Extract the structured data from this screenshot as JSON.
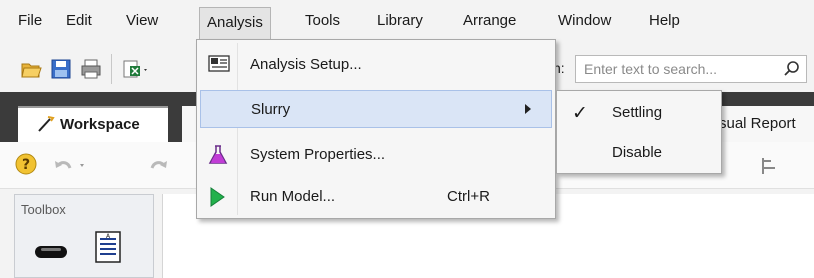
{
  "menubar": {
    "items": [
      {
        "label": "File"
      },
      {
        "label": "Edit"
      },
      {
        "label": "View"
      },
      {
        "label": "Analysis"
      },
      {
        "label": "Tools"
      },
      {
        "label": "Library"
      },
      {
        "label": "Arrange"
      },
      {
        "label": "Window"
      },
      {
        "label": "Help"
      }
    ]
  },
  "toolbar": {
    "search_label": "n:",
    "search_placeholder": "Enter text to search..."
  },
  "tabs": {
    "workspace": "Workspace",
    "visual_report_partial": "sual Report"
  },
  "analysis_menu": {
    "items": [
      {
        "label": "Analysis Setup...",
        "icon": "analysis-setup-icon"
      },
      {
        "label": "Slurry",
        "icon": "",
        "submenu": true
      },
      {
        "label": "System Properties...",
        "icon": "flask-icon"
      },
      {
        "label": "Run Model...",
        "icon": "run-icon",
        "shortcut": "Ctrl+R"
      }
    ]
  },
  "slurry_submenu": {
    "items": [
      {
        "label": "Settling",
        "checked": true
      },
      {
        "label": "Disable",
        "checked": false
      }
    ],
    "check_glyph": "✓"
  },
  "toolbox": {
    "title": "Toolbox"
  },
  "colors": {
    "menu_highlight": "#dae5f6",
    "tabstrip": "#3b3b3b",
    "run_green": "#22b14c"
  }
}
